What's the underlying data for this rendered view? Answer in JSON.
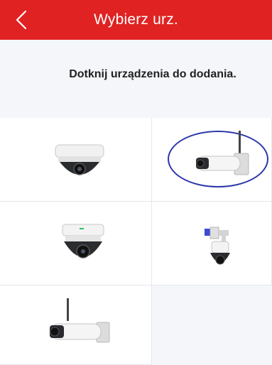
{
  "header": {
    "title": "Wybierz urz.",
    "back_icon": "chevron-left-icon"
  },
  "instruction": "Dotknij urządzenia do dodania.",
  "colors": {
    "header_bg": "#e02222",
    "page_bg": "#f4f6f9",
    "selection": "#2b36a8"
  },
  "devices": [
    {
      "id": "dome-camera",
      "icon": "dome-camera-icon"
    },
    {
      "id": "bullet-camera-wifi",
      "icon": "bullet-camera-wifi-icon",
      "selected": true
    },
    {
      "id": "ptz-dome-camera",
      "icon": "ptz-dome-camera-icon"
    },
    {
      "id": "ptz-camera-wall-mount",
      "icon": "ptz-camera-wall-mount-icon"
    },
    {
      "id": "bullet-camera-wifi-2",
      "icon": "bullet-camera-wifi-icon"
    }
  ]
}
